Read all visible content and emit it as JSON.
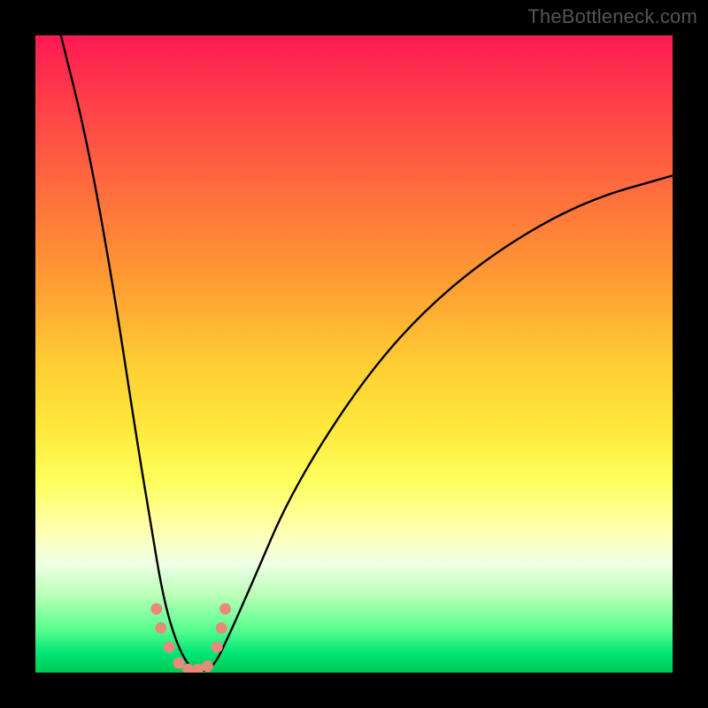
{
  "watermark": "TheBottleneck.com",
  "chart_data": {
    "type": "line",
    "title": "",
    "xlabel": "",
    "ylabel": "",
    "xlim": [
      0,
      100
    ],
    "ylim": [
      0,
      100
    ],
    "grid": false,
    "note": "No numeric axes or tick labels are rendered. Curve shape is a bottleneck V: a steep descending branch from upper-left into a narrow trough near x≈22–28% (trough at y≈0–3%), then a rising branch toward upper-right reaching y≈78% at x=100%. Values are estimates read from pixel geometry only.",
    "series": [
      {
        "name": "curve",
        "x": [
          4,
          8,
          12,
          16,
          18,
          20,
          22,
          24,
          26,
          28,
          30,
          34,
          40,
          50,
          60,
          72,
          86,
          100
        ],
        "y": [
          100,
          84,
          62,
          36,
          24,
          12,
          5,
          1,
          0,
          1,
          5,
          14,
          28,
          44,
          56,
          66,
          74,
          78
        ]
      }
    ],
    "markers": {
      "description": "Small salmon-pink beaded markers along trough of curve",
      "color": "#e78a7a",
      "points_xy": [
        [
          19,
          10
        ],
        [
          19.7,
          7
        ],
        [
          21,
          4
        ],
        [
          22.5,
          1.5
        ],
        [
          24,
          0.5
        ],
        [
          25.5,
          0.5
        ],
        [
          27,
          1
        ],
        [
          28.5,
          4
        ],
        [
          29.2,
          7
        ],
        [
          29.8,
          10
        ]
      ]
    },
    "colors": {
      "frame": "#000000",
      "curve": "#000000",
      "marker_fill": "#e78a7a",
      "gradient_top": "#ff1a53",
      "gradient_bottom": "#00c853"
    }
  }
}
